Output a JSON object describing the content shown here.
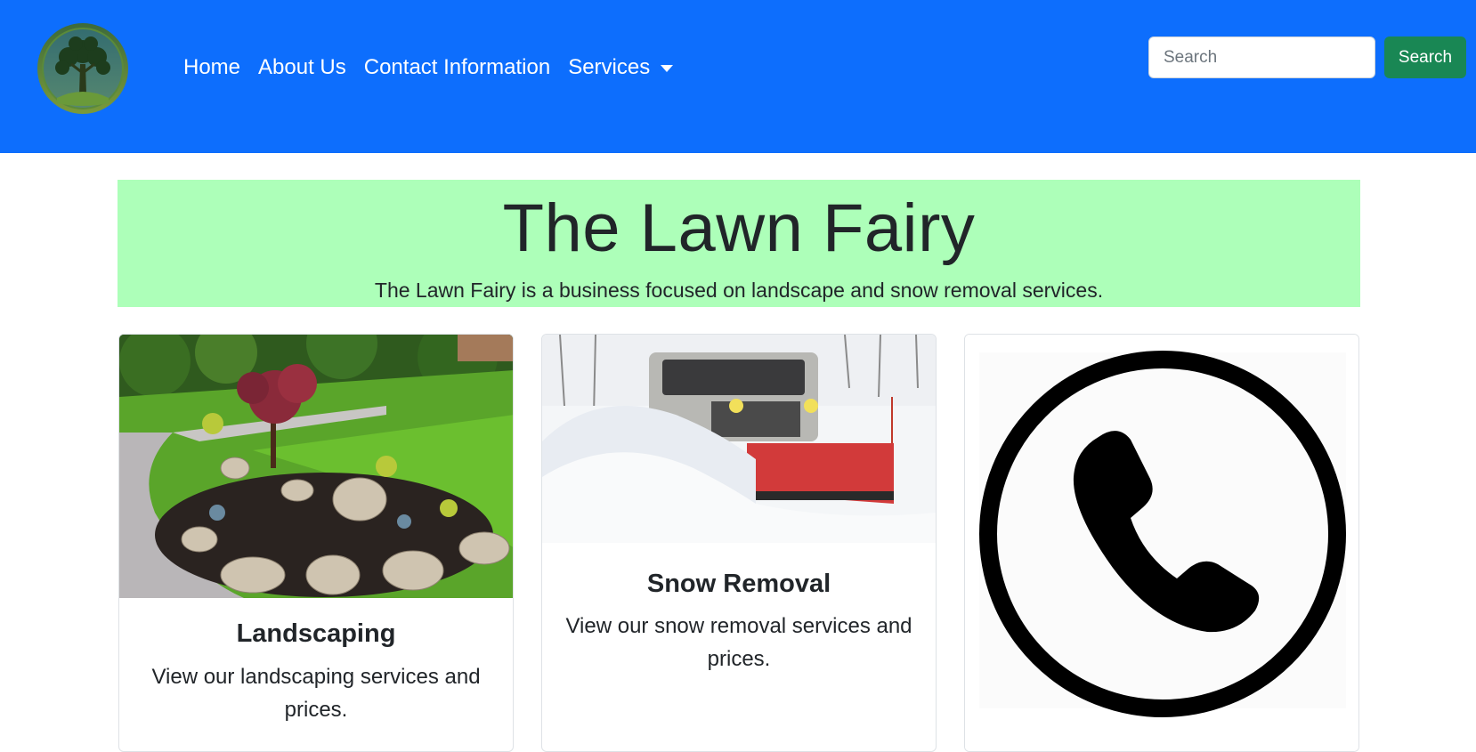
{
  "colors": {
    "navbar": "#0d6efd",
    "search_button": "#198754",
    "hero_background": "#adffb9"
  },
  "navbar": {
    "logo_icon": "tree-logo-icon",
    "links": [
      {
        "label": "Home"
      },
      {
        "label": "About Us"
      },
      {
        "label": "Contact Information"
      },
      {
        "label": "Services",
        "dropdown": true
      }
    ],
    "search": {
      "placeholder": "Search",
      "button_label": "Search"
    }
  },
  "hero": {
    "title": "The Lawn Fairy",
    "subtitle": "The Lawn Fairy is a business focused on landscape and snow removal services."
  },
  "cards": [
    {
      "image_icon": "landscaping-garden-image",
      "title": "Landscaping",
      "text": "View our landscaping services and prices."
    },
    {
      "image_icon": "snow-plow-truck-image",
      "title": "Snow Removal",
      "text": "View our snow removal services and prices."
    },
    {
      "image_icon": "phone-icon"
    }
  ]
}
